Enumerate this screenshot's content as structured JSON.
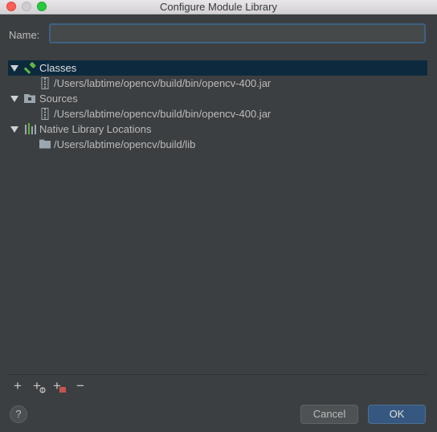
{
  "window": {
    "title": "Configure Module Library"
  },
  "name_field": {
    "label": "Name:",
    "value": ""
  },
  "tree": {
    "classes": {
      "label": "Classes",
      "icon": "hammer-icon",
      "expanded": true,
      "children": [
        "/Users/labtime/opencv/build/bin/opencv-400.jar"
      ]
    },
    "sources": {
      "label": "Sources",
      "icon": "source-folder-icon",
      "expanded": true,
      "children": [
        "/Users/labtime/opencv/build/bin/opencv-400.jar"
      ]
    },
    "native": {
      "label": "Native Library Locations",
      "icon": "native-library-icon",
      "expanded": true,
      "children": [
        "/Users/labtime/opencv/build/lib"
      ]
    }
  },
  "toolbar": {
    "add": "+",
    "remove": "−"
  },
  "buttons": {
    "help": "?",
    "cancel": "Cancel",
    "ok": "OK"
  },
  "colors": {
    "selection": "#0d293e",
    "ok_button": "#365880",
    "background": "#3c3f41"
  }
}
